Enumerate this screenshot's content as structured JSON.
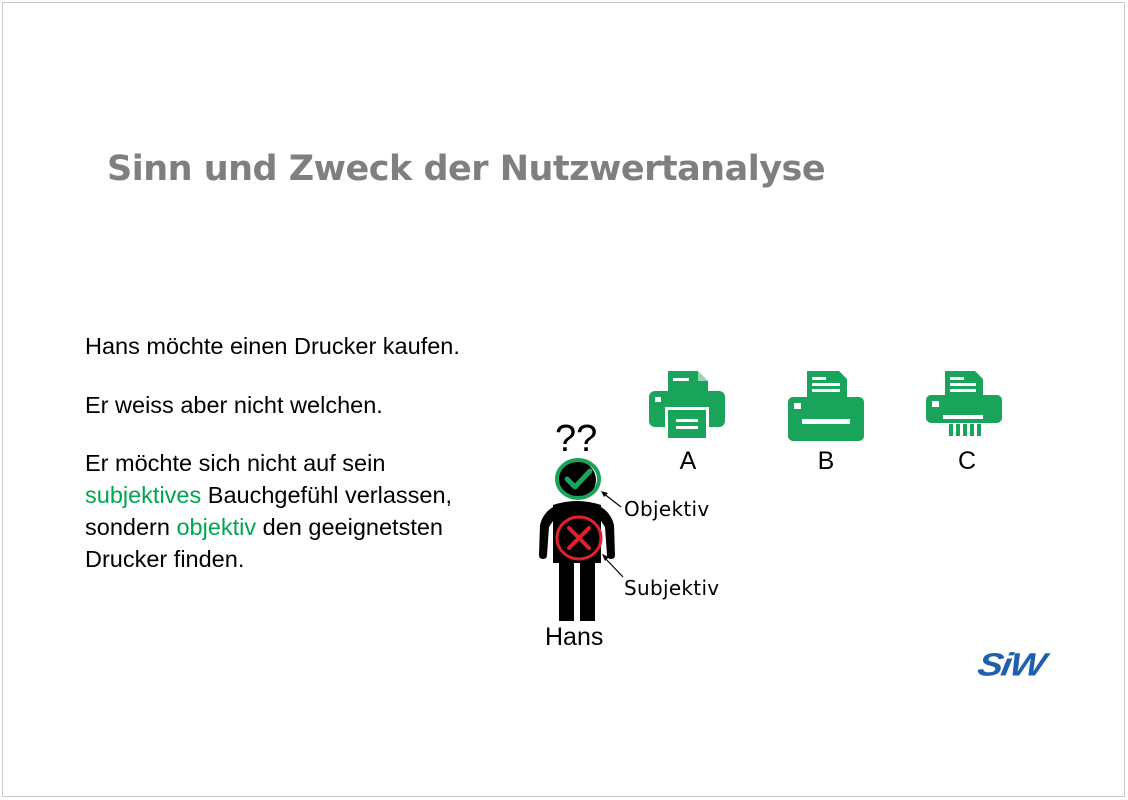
{
  "slide": {
    "title": "Sinn und Zweck der Nutzwertanalyse",
    "paragraphs": {
      "p1": "Hans möchte einen Drucker kaufen.",
      "p2": "Er weiss aber nicht welchen.",
      "p3": {
        "part1": "Er möchte sich nicht auf sein ",
        "part2_green": "subjektives",
        "part3": " Bauchgefühl verlassen, sondern ",
        "part4_green": "objektiv",
        "part5": " den geeignetsten Drucker finden."
      }
    }
  },
  "printers": [
    {
      "label": "A",
      "icon": "printer-icon"
    },
    {
      "label": "B",
      "icon": "fax-printer-icon"
    },
    {
      "label": "C",
      "icon": "shredder-printer-icon"
    }
  ],
  "person": {
    "name": "Hans",
    "question_marks": "??",
    "head_mark": "checkmark-icon",
    "body_mark": "cross-icon",
    "head_annotation": "Objektiv",
    "body_annotation": "Subjektiv"
  },
  "logo": {
    "text": "SiW"
  },
  "colors": {
    "title_gray": "#7f7f7f",
    "accent_green": "#00a650",
    "printer_green": "#1aa35a",
    "cross_red": "#e0202a",
    "logo_blue": "#1f5fb0"
  }
}
